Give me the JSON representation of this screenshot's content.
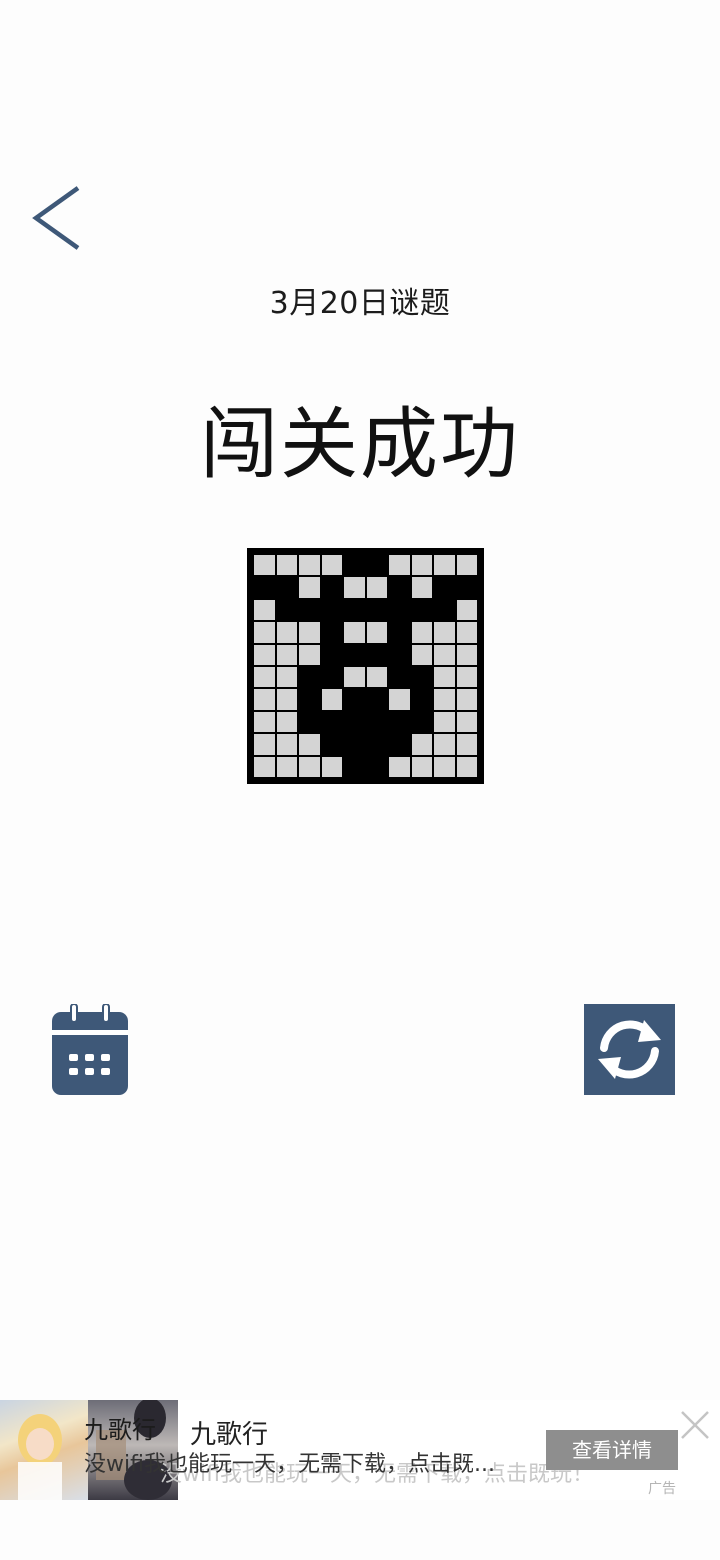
{
  "header": {
    "back_icon": "chevron-left-icon",
    "puzzle_date": "3月20日谜题"
  },
  "result": {
    "title": "闯关成功"
  },
  "nonogram": {
    "rows": 10,
    "cols": 10,
    "cells": [
      [
        0,
        0,
        0,
        0,
        1,
        1,
        0,
        0,
        0,
        0
      ],
      [
        1,
        1,
        0,
        1,
        0,
        0,
        1,
        0,
        1,
        1
      ],
      [
        0,
        1,
        1,
        1,
        1,
        1,
        1,
        1,
        1,
        0
      ],
      [
        0,
        0,
        0,
        1,
        0,
        0,
        1,
        0,
        0,
        0
      ],
      [
        0,
        0,
        0,
        1,
        1,
        1,
        1,
        0,
        0,
        0
      ],
      [
        0,
        0,
        1,
        1,
        0,
        0,
        1,
        1,
        0,
        0
      ],
      [
        0,
        0,
        1,
        0,
        1,
        1,
        0,
        1,
        0,
        0
      ],
      [
        0,
        0,
        1,
        1,
        1,
        1,
        1,
        1,
        0,
        0
      ],
      [
        0,
        0,
        0,
        1,
        1,
        1,
        1,
        0,
        0,
        0
      ],
      [
        0,
        0,
        0,
        0,
        1,
        1,
        0,
        0,
        0,
        0
      ]
    ],
    "filled_color": "#000000",
    "empty_color": "#d4d4d4"
  },
  "actions": {
    "calendar_icon": "calendar-icon",
    "refresh_icon": "refresh-icon",
    "accent_color": "#3e5878"
  },
  "ad": {
    "app_name": "九歌行",
    "app_name_2": "九歌行",
    "description": "没wifi我也能玩一天，无需下载，点击既...",
    "description_ghost": "没wifi我也能玩一天，无需下载，点击既玩！",
    "cta_label": "查看详情",
    "close_icon": "close-icon",
    "tag": "广告"
  }
}
